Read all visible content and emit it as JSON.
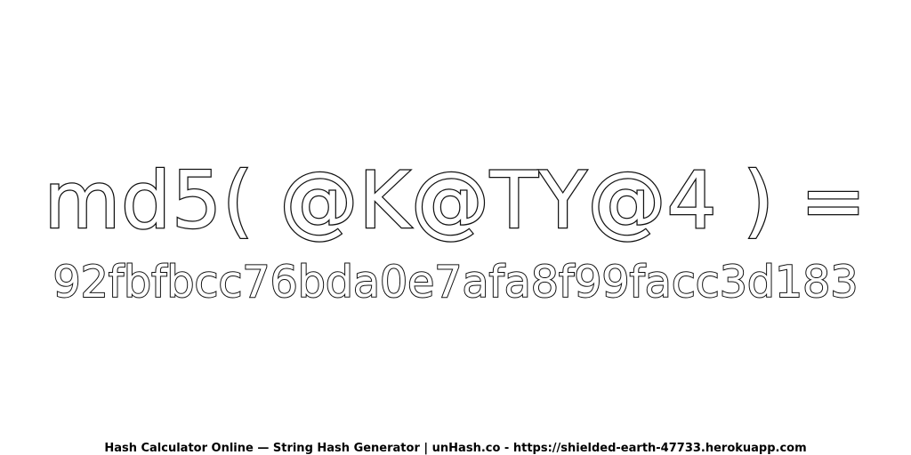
{
  "heading": {
    "expression": "md5( @K@TY@4 ) =",
    "hash": "92fbfbcc76bda0e7afa8f99facc3d183"
  },
  "footer": {
    "text": "Hash Calculator Online — String Hash Generator | unHash.co - https://shielded-earth-47733.herokuapp.com"
  },
  "colors": {
    "background": "#ffffff",
    "outline": "#111111",
    "fill": "#ffffff"
  }
}
